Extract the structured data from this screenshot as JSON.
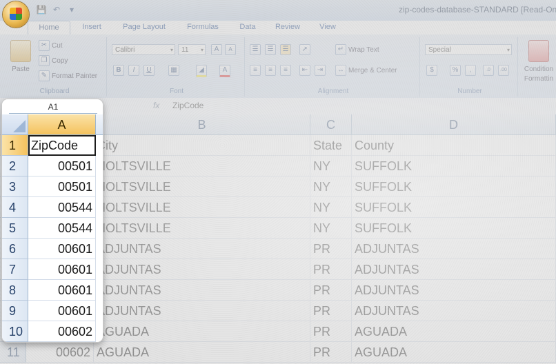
{
  "window": {
    "title": "zip-codes-database-STANDARD  [Read-On"
  },
  "ribbon": {
    "tabs": [
      "Home",
      "Insert",
      "Page Layout",
      "Formulas",
      "Data",
      "Review",
      "View"
    ],
    "clipboard": {
      "label": "Clipboard",
      "paste": "Paste",
      "cut": "Cut",
      "copy": "Copy",
      "format_painter": "Format Painter"
    },
    "font": {
      "label": "Font",
      "name": "Calibri",
      "size": "11",
      "bold": "B",
      "italic": "I",
      "underline": "U"
    },
    "alignment": {
      "label": "Alignment",
      "wrap_text": "Wrap Text",
      "merge_center": "Merge & Center"
    },
    "number": {
      "label": "Number",
      "format": "Special",
      "currency": "$",
      "percent": "%",
      "comma": ","
    },
    "styles": {
      "conditional_line1": "Condition",
      "conditional_line2": "Formattin"
    }
  },
  "formula_bar": {
    "name_box": "A1",
    "fx": "fx",
    "value": "ZipCode"
  },
  "sheet": {
    "columns": [
      "A",
      "B",
      "C",
      "D"
    ],
    "rows": [
      {
        "num": "1",
        "zip": "ZipCode",
        "city": "City",
        "state": "State",
        "county": "County"
      },
      {
        "num": "2",
        "zip": "00501",
        "city": "HOLTSVILLE",
        "state": "NY",
        "county": "SUFFOLK"
      },
      {
        "num": "3",
        "zip": "00501",
        "city": "HOLTSVILLE",
        "state": "NY",
        "county": "SUFFOLK"
      },
      {
        "num": "4",
        "zip": "00544",
        "city": "HOLTSVILLE",
        "state": "NY",
        "county": "SUFFOLK"
      },
      {
        "num": "5",
        "zip": "00544",
        "city": "HOLTSVILLE",
        "state": "NY",
        "county": "SUFFOLK"
      },
      {
        "num": "6",
        "zip": "00601",
        "city": "ADJUNTAS",
        "state": "PR",
        "county": "ADJUNTAS"
      },
      {
        "num": "7",
        "zip": "00601",
        "city": "ADJUNTAS",
        "state": "PR",
        "county": "ADJUNTAS"
      },
      {
        "num": "8",
        "zip": "00601",
        "city": "ADJUNTAS",
        "state": "PR",
        "county": "ADJUNTAS"
      },
      {
        "num": "9",
        "zip": "00601",
        "city": "ADJUNTAS",
        "state": "PR",
        "county": "ADJUNTAS"
      },
      {
        "num": "10",
        "zip": "00602",
        "city": "AGUADA",
        "state": "PR",
        "county": "AGUADA"
      },
      {
        "num": "11",
        "zip": "00602",
        "city": "AGUADA",
        "state": "PR",
        "county": "AGUADA"
      }
    ]
  }
}
